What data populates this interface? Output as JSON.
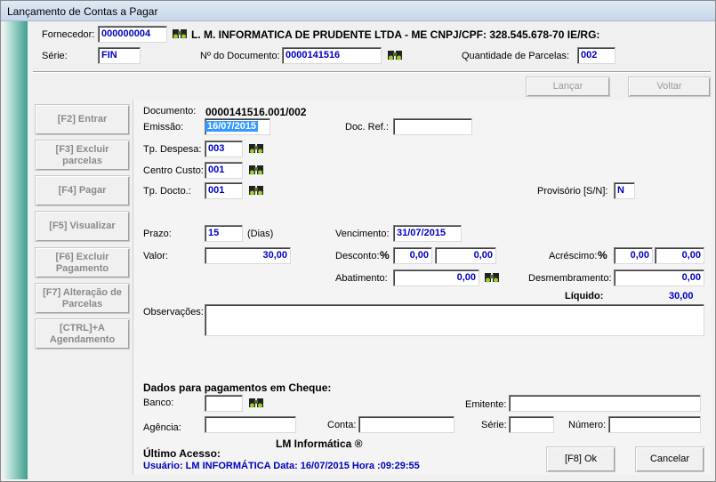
{
  "window": {
    "title": "Lançamento de Contas a Pagar"
  },
  "header": {
    "fornecedor_label": "Fornecedor:",
    "fornecedor_value": "000000004",
    "fornecedor_name": "L. M. INFORMATICA DE PRUDENTE LTDA - ME CNPJ/CPF: 328.545.678-70  IE/RG:",
    "serie_label": "Série:",
    "serie_value": "FIN",
    "documento_label": "Nº do Documento:",
    "documento_value": "0000141516",
    "parcelas_label": "Quantidade de Parcelas:",
    "parcelas_value": "002"
  },
  "actions": {
    "lancar": "Lançar",
    "voltar": "Voltar"
  },
  "sidebar": {
    "items": [
      {
        "label": "[F2]    Entrar"
      },
      {
        "label": "[F3]    Excluir parcelas"
      },
      {
        "label": "[F4]    Pagar"
      },
      {
        "label": "[F5]    Visualizar"
      },
      {
        "label": "[F6]    Excluir Pagamento"
      },
      {
        "label": "[F7]    Alteração de Parcelas"
      },
      {
        "label": "[CTRL]+A Agendamento"
      }
    ]
  },
  "form": {
    "documento_label": "Documento:",
    "documento_value": "0000141516.001/002",
    "emissao_label": "Emissão:",
    "emissao_value": "16/07/2015",
    "docref_label": "Doc. Ref.:",
    "docref_value": "",
    "tpdespesa_label": "Tp. Despesa:",
    "tpdespesa_value": "003",
    "centrocusto_label": "Centro Custo:",
    "centrocusto_value": "001",
    "tpdocto_label": "Tp. Docto.:",
    "tpdocto_value": "001",
    "provisorio_label": "Provisório [S/N]:",
    "provisorio_value": "N",
    "prazo_label": "Prazo:",
    "prazo_value": "15",
    "dias_label": "(Dias)",
    "vencimento_label": "Vencimento:",
    "vencimento_value": "31/07/2015",
    "valor_label": "Valor:",
    "valor_value": "30,00",
    "desconto_label": "Desconto:",
    "desconto_pct": "0,00",
    "desconto_value": "0,00",
    "acrescimo_label": "Acréscimo:",
    "acrescimo_pct": "0,00",
    "acrescimo_value": "0,00",
    "abatimento_label": "Abatimento:",
    "abatimento_value": "0,00",
    "desmembramento_label": "Desmembramento:",
    "desmembramento_value": "0,00",
    "liquido_label": "Líquido:",
    "liquido_value": "30,00",
    "observacoes_label": "Observações:",
    "percent_symbol": "%"
  },
  "cheque": {
    "title": "Dados para pagamentos em Cheque:",
    "banco_label": "Banco:",
    "emitente_label": "Emitente:",
    "agencia_label": "Agência:",
    "conta_label": "Conta:",
    "serie_label": "Série:",
    "numero_label": "Número:"
  },
  "footer": {
    "ultimo_acesso": "Último Acesso:",
    "brand": "LM Informática ®",
    "usuario_line": "Usuário: LM INFORMÁTICA  Data: 16/07/2015  Hora :09:29:55",
    "ok_label": "[F8]   Ok",
    "cancelar_label": "Cancelar"
  }
}
